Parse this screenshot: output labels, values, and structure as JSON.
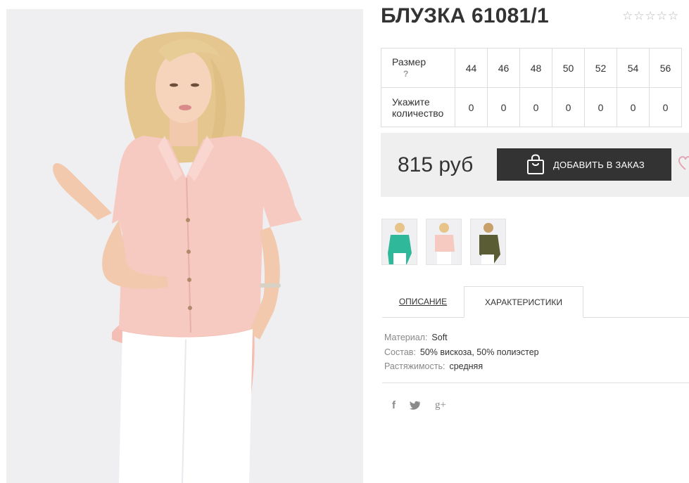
{
  "product": {
    "title": "БЛУЗКА 61081/1",
    "rating_stars": [
      "☆",
      "☆",
      "☆",
      "☆",
      "☆"
    ],
    "photo_alt_icon": "product-photo"
  },
  "size_table": {
    "size_label": "Размер",
    "size_help": "?",
    "qty_label_line1": "Укажите",
    "qty_label_line2": "количество",
    "sizes": [
      "44",
      "46",
      "48",
      "50",
      "52",
      "54",
      "56"
    ],
    "quantities": [
      "0",
      "0",
      "0",
      "0",
      "0",
      "0",
      "0"
    ]
  },
  "purchase": {
    "price": "815 руб",
    "add_button_label": "ДОБАВИТЬ В ЗАКАЗ",
    "bag_icon": "shopping-bag-icon",
    "heart_icon": "heart-icon"
  },
  "thumbnails": [
    {
      "name": "thumbnail-mint"
    },
    {
      "name": "thumbnail-pink"
    },
    {
      "name": "thumbnail-olive"
    }
  ],
  "tabs": {
    "description": "ОПИСАНИЕ",
    "characteristics": "ХАРАКТЕРИСТИКИ",
    "active": "characteristics"
  },
  "specs": [
    {
      "key": "Материал:",
      "value": "Soft"
    },
    {
      "key": "Состав:",
      "value": "50% вискоза, 50% полиэстер"
    },
    {
      "key": "Растяжимость:",
      "value": "средняя"
    }
  ],
  "social": {
    "facebook": "f",
    "twitter": "🐦",
    "googleplus": "g+"
  },
  "colors": {
    "button_bg": "#333333",
    "price_box_bg": "#efefef",
    "heart": "#e3a5b4",
    "blouse": "#f6c9c1",
    "mint": "#2fb99a",
    "olive": "#5a5d34"
  }
}
